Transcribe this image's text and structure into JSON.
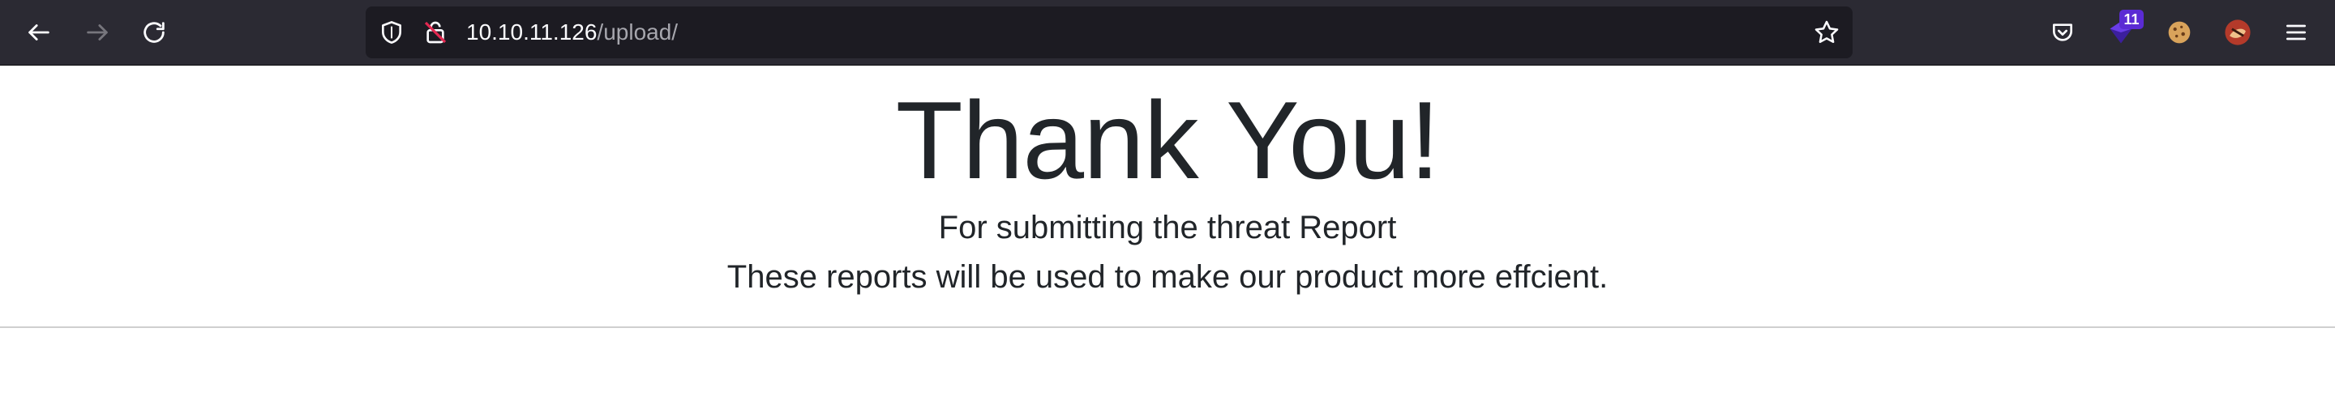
{
  "browser": {
    "url_host": "10.10.11.126",
    "url_path": "/upload/",
    "extension_badge": "11",
    "icons": [
      "back-arrow-icon",
      "forward-arrow-icon",
      "reload-icon",
      "shield-icon",
      "insecure-lock-icon",
      "star-icon",
      "pocket-icon",
      "extension-icon",
      "cookie-icon",
      "avatar-icon",
      "menu-icon"
    ]
  },
  "page": {
    "headline": "Thank You!",
    "subheading": "For submitting the threat Report",
    "message": "These reports will be used to make our product more effcient."
  }
}
